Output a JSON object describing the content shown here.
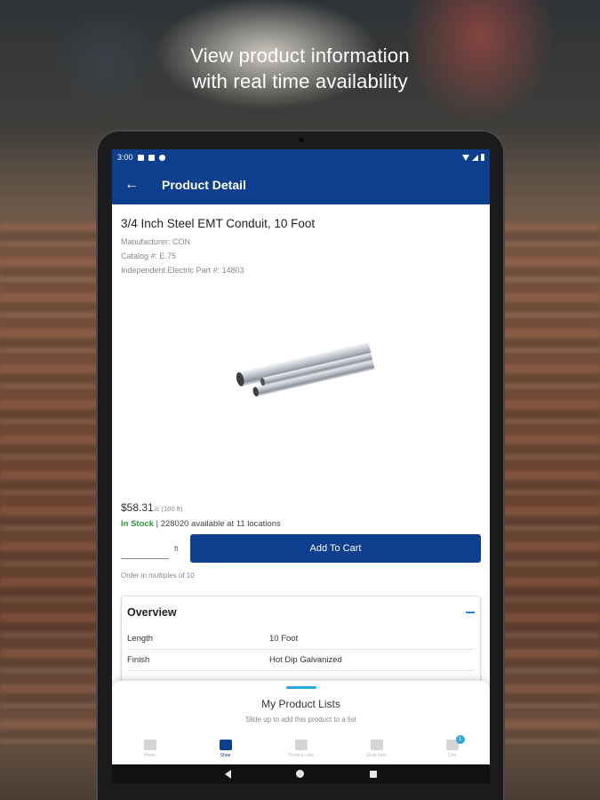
{
  "promo": {
    "line1": "View product information",
    "line2": "with real time availability"
  },
  "statusbar": {
    "time": "3:00"
  },
  "appbar": {
    "back_icon": "arrow-left-icon",
    "title": "Product Detail"
  },
  "product": {
    "title": "3/4 Inch Steel EMT Conduit, 10 Foot",
    "manufacturer": "Manufacturer: CON",
    "catalog": "Catalog #: E.75",
    "part": "Independent Electric Part #: 14803",
    "price": "$58.31",
    "price_unit": "/c (100 ft)",
    "stock_status": "In Stock",
    "availability": "| 228020 available at 11 locations",
    "qty_value": "",
    "qty_unit": "ft",
    "add_to_cart": "Add To Cart",
    "multiples_note": "Order in multiples of 10"
  },
  "overview": {
    "title": "Overview",
    "rows": [
      {
        "key": "Length",
        "value": "10 Foot"
      },
      {
        "key": "Finish",
        "value": "Hot Dip Galvanized"
      }
    ]
  },
  "product_lists": {
    "title": "My Product Lists",
    "subtitle": "Slide up to add this product to a list"
  },
  "bottom_nav": {
    "items": [
      {
        "label": "Home",
        "icon": "home-icon"
      },
      {
        "label": "Shop",
        "icon": "tag-icon"
      },
      {
        "label": "Product Lists",
        "icon": "list-icon"
      },
      {
        "label": "Scan Item",
        "icon": "scan-icon"
      },
      {
        "label": "Cart",
        "icon": "cart-icon"
      }
    ],
    "cart_badge": "1"
  },
  "colors": {
    "brand_blue": "#0d3f8f",
    "in_stock_green": "#2e9a3c",
    "accent_cyan": "#2aa7de"
  }
}
